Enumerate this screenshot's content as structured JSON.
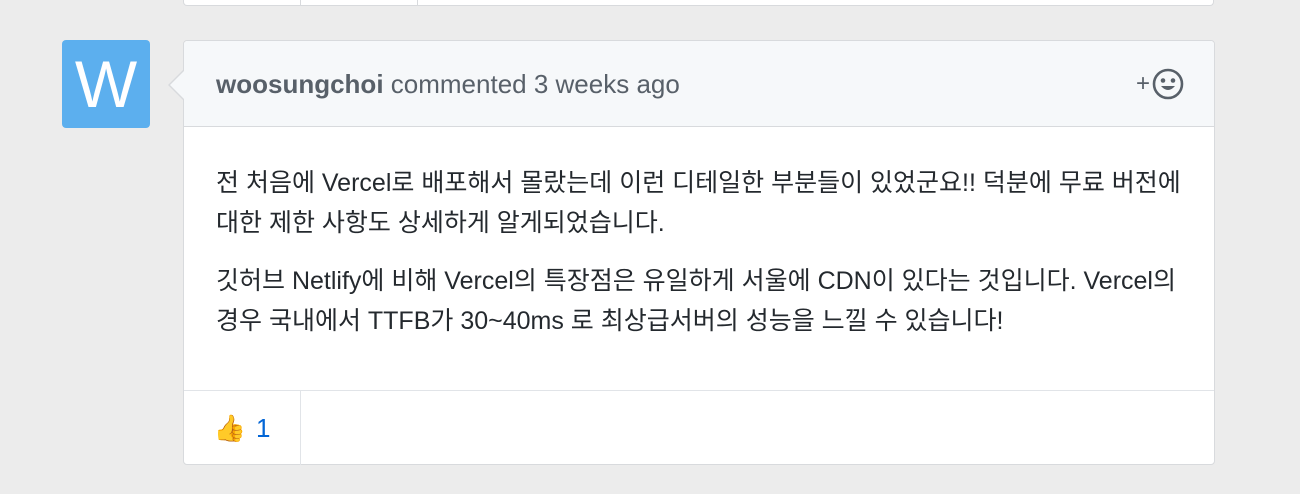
{
  "avatar": {
    "letter": "W",
    "color": "#5cafee"
  },
  "comment": {
    "author": "woosungchoi",
    "action": " commented ",
    "time": "3 weeks ago",
    "reaction_add_plus": "+",
    "reaction_add_icon": "smiley-icon",
    "paragraphs": [
      "전 처음에 Vercel로 배포해서 몰랐는데 이런 디테일한 부분들이 있었군요!! 덕분에 무료 버전에 대한 제한 사항도 상세하게 알게되었습니다.",
      "깃허브 Netlify에 비해 Vercel의 특장점은 유일하게 서울에 CDN이 있다는 것입니다. Vercel의 경우 국내에서 TTFB가 30~40ms 로 최상급서버의 성능을 느낄 수 있습니다!"
    ],
    "reactions": [
      {
        "emoji": "👍",
        "icon": "thumbs-up-icon",
        "count": "1"
      }
    ]
  }
}
